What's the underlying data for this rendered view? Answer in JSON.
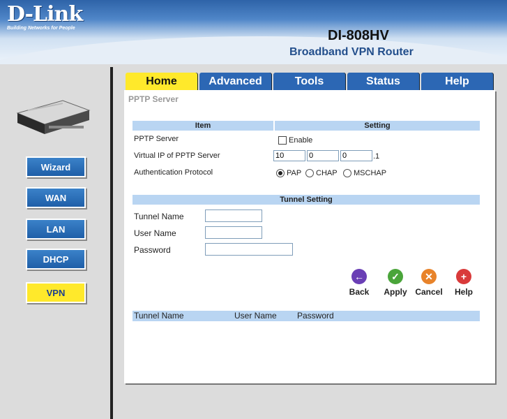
{
  "brand": {
    "logo": "D-Link",
    "tagline": "Building Networks for People"
  },
  "product": {
    "model": "DI-808HV",
    "name": "Broadband VPN Router"
  },
  "sidebar": {
    "items": [
      {
        "label": "Wizard"
      },
      {
        "label": "WAN"
      },
      {
        "label": "LAN"
      },
      {
        "label": "DHCP"
      },
      {
        "label": "VPN",
        "active": true
      }
    ]
  },
  "tabs": [
    {
      "label": "Home"
    },
    {
      "label": "Advanced"
    },
    {
      "label": "Tools"
    },
    {
      "label": "Status"
    },
    {
      "label": "Help"
    }
  ],
  "panel": {
    "title": "PPTP Server",
    "col_item": "Item",
    "col_setting": "Setting",
    "pptp_label": "PPTP Server",
    "enable_label": "Enable",
    "enable_checked": false,
    "vip_label": "Virtual IP of PPTP Server",
    "ip": [
      "10",
      "0",
      "0"
    ],
    "ip_last": ".1",
    "auth_label": "Authentication Protocol",
    "auth_options": [
      "PAP",
      "CHAP",
      "MSCHAP"
    ],
    "auth_selected": "PAP",
    "tunnel_header": "Tunnel Setting",
    "tunnel_name_label": "Tunnel Name",
    "user_name_label": "User Name",
    "password_label": "Password",
    "tunnel_name_value": "",
    "user_name_value": "",
    "password_value": "",
    "buttons": {
      "back": "Back",
      "apply": "Apply",
      "cancel": "Cancel",
      "help": "Help"
    },
    "list_columns": [
      "Tunnel Name",
      "User Name",
      "Password"
    ]
  },
  "colors": {
    "back": "#6a3fb5",
    "apply": "#4aa53a",
    "cancel": "#e8832a",
    "help": "#d93a3a"
  }
}
